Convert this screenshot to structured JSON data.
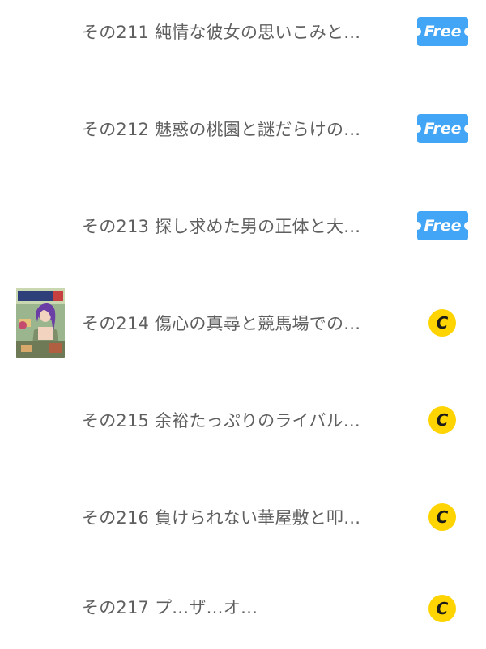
{
  "episodes": [
    {
      "title": "その211 純情な彼女の思いこみと…",
      "badge": "Free",
      "has_thumbnail": false
    },
    {
      "title": "その212 魅惑の桃園と謎だらけの…",
      "badge": "Free",
      "has_thumbnail": false
    },
    {
      "title": "その213 探し求めた男の正体と大…",
      "badge": "Free",
      "has_thumbnail": false
    },
    {
      "title": "その214 傷心の真尋と競馬場での…",
      "badge": "C",
      "has_thumbnail": true
    },
    {
      "title": "その215 余裕たっぷりのライバル…",
      "badge": "C",
      "has_thumbnail": false
    },
    {
      "title": "その216 負けられない華屋敷と叩…",
      "badge": "C",
      "has_thumbnail": false
    },
    {
      "title": "その217 プ…ザ…オ…",
      "badge": "C",
      "has_thumbnail": false
    }
  ],
  "colors": {
    "free_badge": "#42A5F5",
    "coin_badge": "#FFD400",
    "title_text": "#5F5F5F"
  },
  "icons": {
    "free": "free-ticket-icon",
    "coin": "coin-c-icon"
  }
}
